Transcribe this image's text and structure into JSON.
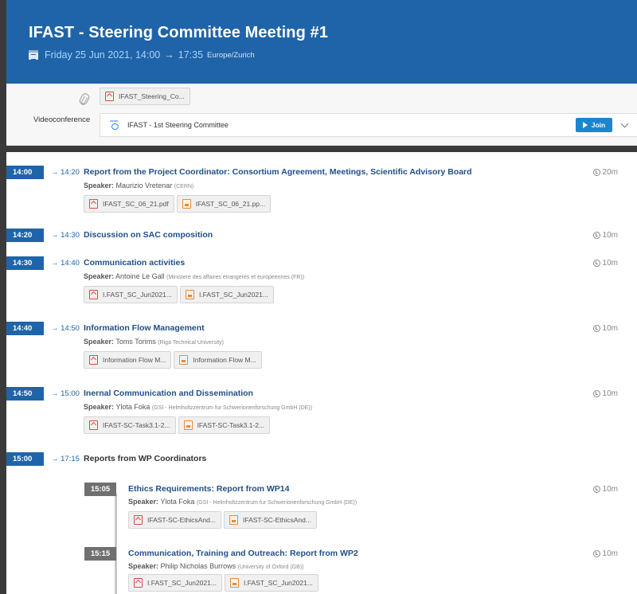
{
  "event": {
    "title": "IFAST - Steering Committee Meeting #1",
    "date_start": "Friday 25 Jun 2021, 14:00",
    "arrow": "→",
    "time_end": "17:35",
    "timezone": "Europe/Zurich"
  },
  "attachments": {
    "files": [
      {
        "name": "IFAST_Steering_Co...",
        "type": "pdf"
      }
    ]
  },
  "videoconference": {
    "label": "Videoconference",
    "name": "IFAST - 1st Steering Committee",
    "join_label": "Join",
    "icon": "zoom-icon",
    "zoom_text": "zoom"
  },
  "contributions": [
    {
      "start": "14:00",
      "end": "→ 14:20",
      "title": "Report from the Project Coordinator: Consortium Agreement, Meetings, Scientific Advisory Board",
      "duration": "20m",
      "speaker_label": "Speaker:",
      "speaker": "Maurizio Vretenar",
      "affiliation": "(CERN)",
      "files": [
        {
          "name": "IFAST_SC_06_21.pdf",
          "type": "pdf"
        },
        {
          "name": "IFAST_SC_06_21.pp...",
          "type": "ppt"
        }
      ]
    },
    {
      "start": "14:20",
      "end": "→ 14:30",
      "title": "Discussion on SAC composition",
      "duration": "10m"
    },
    {
      "start": "14:30",
      "end": "→ 14:40",
      "title": "Communication activities",
      "duration": "10m",
      "speaker_label": "Speaker:",
      "speaker": "Antoine Le Gall",
      "affiliation": "(Ministere des affaires etrangeres et europeennes (FR))",
      "files": [
        {
          "name": "I.FAST_SC_Jun2021...",
          "type": "pdf"
        },
        {
          "name": "I.FAST_SC_Jun2021...",
          "type": "ppt"
        }
      ]
    },
    {
      "start": "14:40",
      "end": "→ 14:50",
      "title": "Information Flow Management",
      "duration": "10m",
      "speaker_label": "Speaker:",
      "speaker": "Toms Torims",
      "affiliation": "(Riga Technical University)",
      "files": [
        {
          "name": "Information Flow M...",
          "type": "pdf"
        },
        {
          "name": "Information Flow M...",
          "type": "ppt"
        }
      ]
    },
    {
      "start": "14:50",
      "end": "→ 15:00",
      "title": "Inernal Communication and Dissemination",
      "duration": "10m",
      "speaker_label": "Speaker:",
      "speaker": "Ylota Foka",
      "affiliation": "(GSI - Helmholtzzentrum fur Schwerionenforschung GmbH (DE))",
      "files": [
        {
          "name": "IFAST-SC-Task3.1-2...",
          "type": "pdf"
        },
        {
          "name": "IFAST-SC-Task3.1-2...",
          "type": "ppt"
        }
      ]
    }
  ],
  "session": {
    "start": "15:00",
    "end": "→ 17:15",
    "title": "Reports from WP Coordinators",
    "items": [
      {
        "start": "15:05",
        "title": "Ethics Requirements: Report from WP14",
        "duration": "10m",
        "speaker_label": "Speaker:",
        "speaker": "Ylota Foka",
        "affiliation": "(GSI - Helmholtzzentrum fur Schwerionenforschung GmbH (DE))",
        "files": [
          {
            "name": "IFAST-SC-EthicsAnd...",
            "type": "pdf"
          },
          {
            "name": "IFAST-SC-EthicsAnd...",
            "type": "ppt"
          }
        ]
      },
      {
        "start": "15:15",
        "title": "Communication, Training and Outreach: Report from WP2",
        "duration": "10m",
        "speaker_label": "Speaker:",
        "speaker": "Philip Nicholas Burrows",
        "affiliation": "(University of Oxford (GB))",
        "files": [
          {
            "name": "I.FAST_SC_Jun2021...",
            "type": "pdf"
          },
          {
            "name": "I.FAST_SC_Jun2021...",
            "type": "ppt"
          }
        ]
      }
    ]
  },
  "colors": {
    "header": "#1f64a8",
    "title_link": "#1f4f89",
    "join": "#1a86d0",
    "pdf": "#e04a4a",
    "ppt": "#e8893a"
  }
}
